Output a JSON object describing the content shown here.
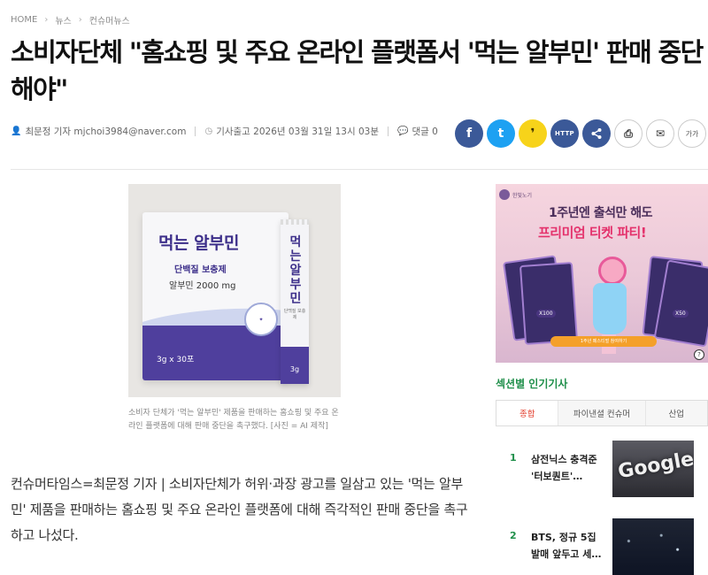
{
  "breadcrumb": {
    "home": "HOME",
    "news": "뉴스",
    "section": "컨슈머뉴스"
  },
  "article": {
    "title": "소비자단체 \"홈쇼핑 및 주요 온라인 플랫폼서 '먹는 알부민' 판매 중단해야\"",
    "author": "최문정 기자 mjchoi3984@naver.com",
    "published": "기사출고 2026년 03월 31일 13시 03분",
    "comments": "댓글 0",
    "caption": "소비자 단체가 '먹는 알부민' 제품을 판매하는 홈쇼핑 및 주요 온라인 플랫폼에 대해 판매 중단을 촉구했다. [사진 = AI 제작]",
    "body": "컨슈머타임스=최문정 기자 | 소비자단체가 허위·과장 광고를 일삼고 있는 '먹는 알부민' 제품을 판매하는 홈쇼핑 및 주요 온라인 플랫폼에 대해 즉각적인 판매 중단을 촉구하고 나섰다."
  },
  "product": {
    "box_title": "먹는 알부민",
    "box_subtitle": "단백질 보충제",
    "box_dose": "알부민 2000 mg",
    "box_count": "3g x 30포",
    "stick_title": "먹는 알부민",
    "stick_sub": "단백질 보충제",
    "stick_gram": "3g"
  },
  "share": {
    "facebook": "f",
    "twitter": "t",
    "kakao": "❜",
    "url": "HTTP",
    "print": "⎙",
    "email": "✉",
    "font": "가가"
  },
  "ad": {
    "brand": "한빛노기",
    "headline": "1주년엔 출석만 해도",
    "highlight": "프리미엄 티켓 파티!",
    "x100": "X100",
    "x50": "X50",
    "button": "1주년 페스티벌 참여하기"
  },
  "sidebar": {
    "title": "섹션별 인기기사",
    "tabs": [
      "종합",
      "파이낸셜 컨슈머",
      "산업"
    ],
    "items": [
      {
        "rank": "1",
        "title": "삼전닉스 충격준 '터보퀀트'…",
        "thumb_text": "Google"
      },
      {
        "rank": "2",
        "title": "BTS, 정규 5집 발매 앞두고 세…",
        "thumb_text": ""
      }
    ]
  }
}
